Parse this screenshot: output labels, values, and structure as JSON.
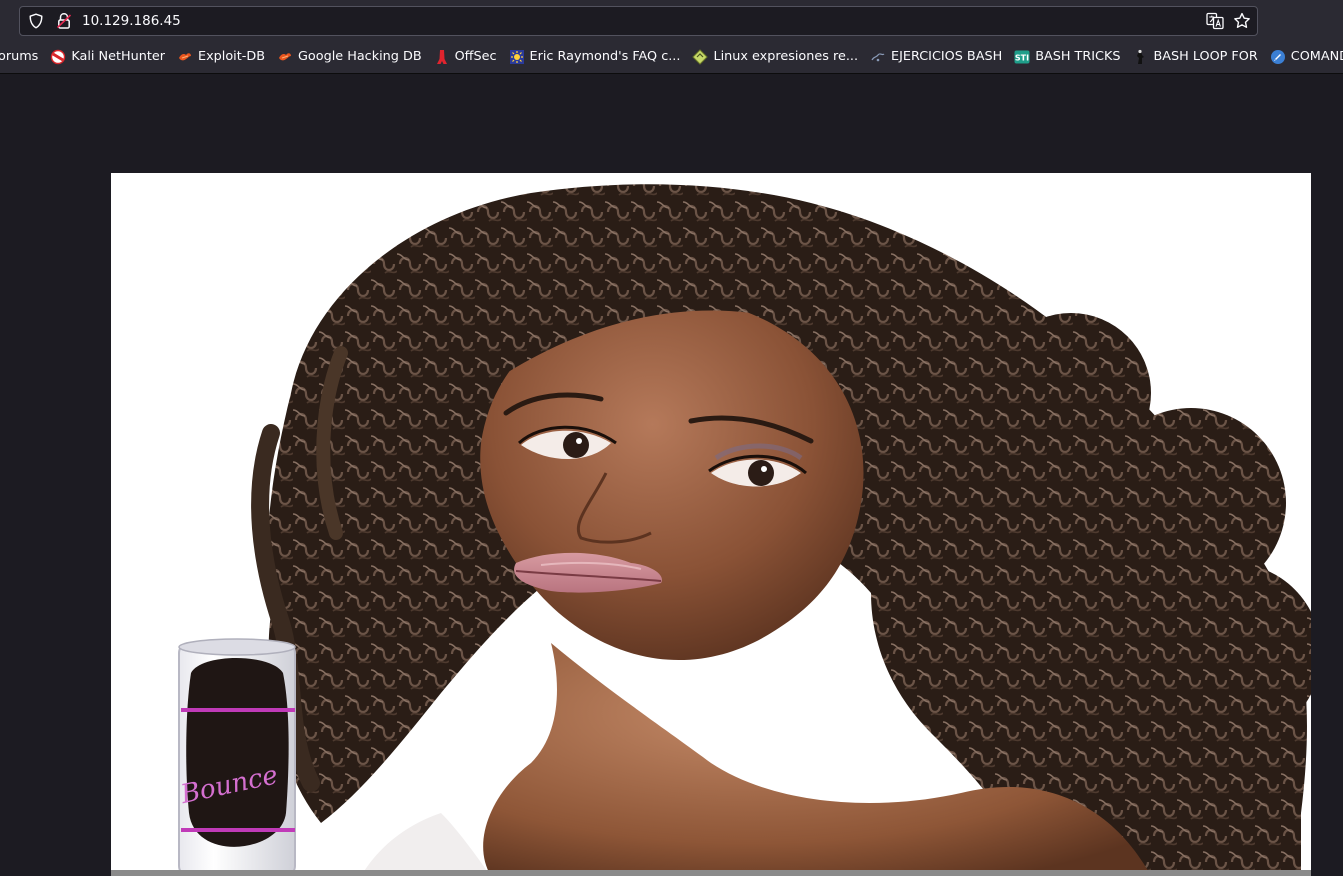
{
  "browser": {
    "url": "10.129.186.45"
  },
  "bookmarks": [
    {
      "label": "orums",
      "icon": "none"
    },
    {
      "label": "Kali NetHunter",
      "icon": "kali-nethunter-icon"
    },
    {
      "label": "Exploit-DB",
      "icon": "exploit-db-icon"
    },
    {
      "label": "Google Hacking DB",
      "icon": "ghdb-icon"
    },
    {
      "label": "OffSec",
      "icon": "offsec-icon"
    },
    {
      "label": "Eric Raymond's FAQ c...",
      "icon": "eric-raymond-icon"
    },
    {
      "label": "Linux expresiones re...",
      "icon": "linux-regex-icon"
    },
    {
      "label": "EJERCICIOS BASH",
      "icon": "ejercicios-bash-icon"
    },
    {
      "label": "BASH TRICKS",
      "icon": "bash-tricks-icon"
    },
    {
      "label": "BASH LOOP FOR",
      "icon": "bash-loop-icon"
    },
    {
      "label": "COMANDO A",
      "icon": "comando-icon"
    }
  ],
  "page": {
    "image_subject": "hero-photo",
    "product_label": "Bounce"
  },
  "colors": {
    "chrome": "#2b2a33",
    "page_bg": "#1c1b22",
    "text": "#fbfbfe"
  }
}
